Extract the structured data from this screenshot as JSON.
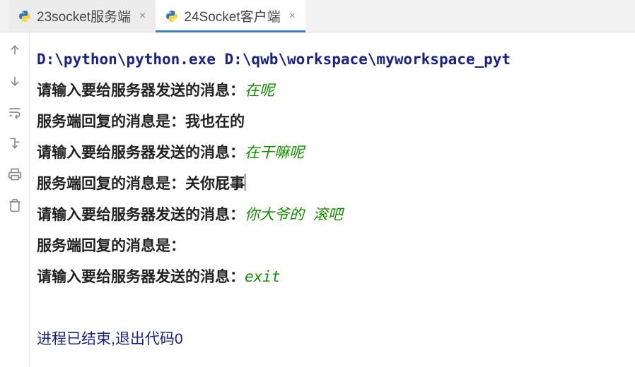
{
  "tabs": {
    "tab1": {
      "label": "23socket服务端",
      "active": false
    },
    "tab2": {
      "label": "24Socket客户端",
      "active": true
    }
  },
  "console": {
    "cmdline": "D:\\python\\python.exe D:\\qwb\\workspace\\myworkspace_pyt",
    "lines": [
      {
        "prompt": "请输入要给服务器发送的消息：",
        "input": "在呢"
      },
      {
        "prompt": "服务端回复的消息是：",
        "reply": "我也在的"
      },
      {
        "prompt": "请输入要给服务器发送的消息：",
        "input": "在干嘛呢"
      },
      {
        "prompt": "服务端回复的消息是：",
        "reply": "关你屁事",
        "cursor": true
      },
      {
        "prompt": "请输入要给服务器发送的消息：",
        "input": "你大爷的 滚吧"
      },
      {
        "prompt": "服务端回复的消息是：",
        "reply": ""
      },
      {
        "prompt": "请输入要给服务器发送的消息：",
        "input": "exit"
      }
    ],
    "exit_msg": "进程已结束,退出代码0"
  },
  "icons": {
    "arrow_up": "arrow-up-icon",
    "arrow_down": "arrow-down-icon",
    "wrap": "wrap-icon",
    "step": "step-down-icon",
    "print": "print-icon",
    "trash": "trash-icon"
  }
}
